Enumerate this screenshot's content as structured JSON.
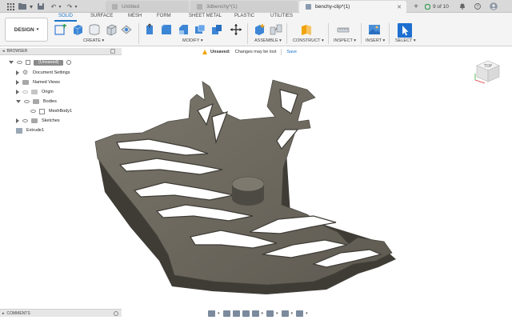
{
  "window": {
    "tabs": [
      {
        "label": "Untitled",
        "active": false
      },
      {
        "label": "3dbenchy*(1)",
        "active": false
      },
      {
        "label": "benchy-clip*(1)",
        "active": true
      }
    ],
    "page_counter": "9 of 10"
  },
  "toolbar": {
    "design_label": "DESIGN",
    "workspace_tabs": [
      "SOLID",
      "SURFACE",
      "MESH",
      "FORM",
      "SHEET METAL",
      "PLASTIC",
      "UTILITIES"
    ],
    "active_workspace": "SOLID",
    "groups": [
      "CREATE",
      "MODIFY",
      "ASSEMBLE",
      "CONSTRUCT",
      "INSPECT",
      "INSERT",
      "SELECT"
    ]
  },
  "notice": {
    "status": "Unsaved:",
    "message": "Changes may be lost",
    "action": "Save"
  },
  "browser": {
    "title": "BROWSER",
    "items": [
      {
        "label": "(Unsaved)"
      },
      {
        "label": "Document Settings"
      },
      {
        "label": "Named Views"
      },
      {
        "label": "Origin"
      },
      {
        "label": "Bodies"
      },
      {
        "label": "MeshBody1"
      },
      {
        "label": "Sketches"
      },
      {
        "label": "Extrude1"
      }
    ]
  },
  "comments": {
    "title": "COMMENTS"
  },
  "viewcube": {
    "face": "TOP"
  },
  "colors": {
    "accent": "#1a73c8",
    "part": "#6e6a60",
    "part_dark": "#3f3c36",
    "warning": "#f0a30a"
  }
}
